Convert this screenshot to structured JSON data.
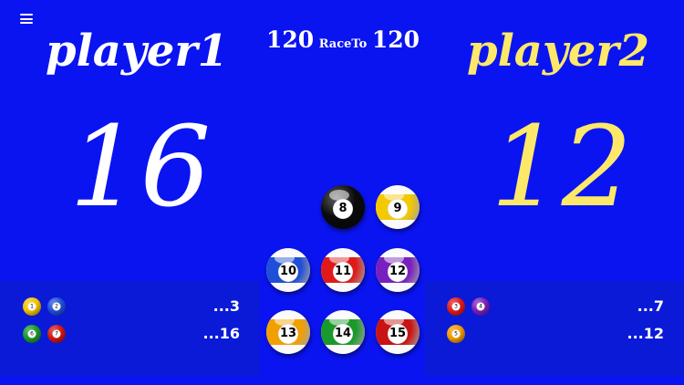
{
  "menu": {
    "icon": "hamburger-icon"
  },
  "player1": {
    "name": "player1",
    "score": "16",
    "color": "#ffffff",
    "rows": [
      {
        "balls": [
          {
            "n": "1",
            "color": "#f2c200"
          },
          {
            "n": "2",
            "color": "#1f4fd8"
          }
        ],
        "value": "...3"
      },
      {
        "balls": [
          {
            "n": "6",
            "color": "#1a9a2a"
          },
          {
            "n": "7",
            "color": "#d01515"
          }
        ],
        "value": "...16"
      }
    ]
  },
  "player2": {
    "name": "player2",
    "score": "12",
    "color": "#fde86a",
    "rows": [
      {
        "balls": [
          {
            "n": "3",
            "color": "#e01a1a"
          },
          {
            "n": "4",
            "color": "#7a1fbf"
          }
        ],
        "value": "...7"
      },
      {
        "balls": [
          {
            "n": "5",
            "color": "#f29a00"
          }
        ],
        "value": "...12"
      }
    ]
  },
  "race": {
    "left": "120",
    "label": "RaceTo",
    "right": "120"
  },
  "balls": [
    {
      "n": "8",
      "color": "#0b0b0b",
      "stripe": false
    },
    {
      "n": "9",
      "color": "#f4c900",
      "stripe": true
    },
    {
      "n": "10",
      "color": "#1f4fd8",
      "stripe": true
    },
    {
      "n": "11",
      "color": "#e01a1a",
      "stripe": true
    },
    {
      "n": "12",
      "color": "#7a1fbf",
      "stripe": true
    },
    {
      "n": "13",
      "color": "#f2a000",
      "stripe": true
    },
    {
      "n": "14",
      "color": "#1a9a2a",
      "stripe": true
    },
    {
      "n": "15",
      "color": "#c81414",
      "stripe": true
    }
  ]
}
